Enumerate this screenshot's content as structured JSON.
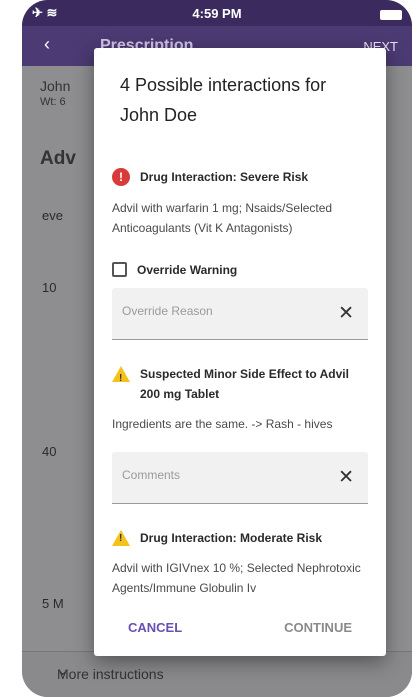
{
  "status_bar": {
    "time": "4:59 PM"
  },
  "app_bar": {
    "back_icon": "back-arrow-icon",
    "title": "Prescription",
    "next_label": "NEXT"
  },
  "background": {
    "patient_name": "John",
    "weight": "Wt: 6",
    "heading": "Adv",
    "field_values": [
      "eve",
      "10",
      "40",
      "5 M"
    ],
    "more_instructions": "More instructions"
  },
  "dialog": {
    "title": "4 Possible interactions for John Doe",
    "severe": {
      "icon": "error-icon",
      "heading": "Drug Interaction: Severe Risk",
      "description": "Advil with warfarin 1 mg; Nsaids/Selected Anticoagulants (Vit K Antagonists)"
    },
    "override": {
      "checkbox_label": "Override Warning",
      "checked": false
    },
    "override_reason": {
      "placeholder": "Override Reason",
      "value": ""
    },
    "side_effect": {
      "icon": "warning-icon",
      "heading": "Suspected Minor Side Effect to Advil 200 mg Tablet",
      "description": "Ingredients are the same. -> Rash - hives"
    },
    "comments": {
      "placeholder": "Comments",
      "value": ""
    },
    "moderate": {
      "icon": "warning-icon",
      "heading": "Drug Interaction: Moderate Risk",
      "description": "Advil with IGIVnex 10 %; Selected Nephrotoxic Agents/Immune Globulin Iv"
    },
    "cancel_label": "CANCEL",
    "continue_label": "CONTINUE"
  },
  "colors": {
    "accent": "#6a4fb3",
    "app_bar": "#4b3a73",
    "error": "#d93a3a",
    "warning": "#f4c21b"
  }
}
